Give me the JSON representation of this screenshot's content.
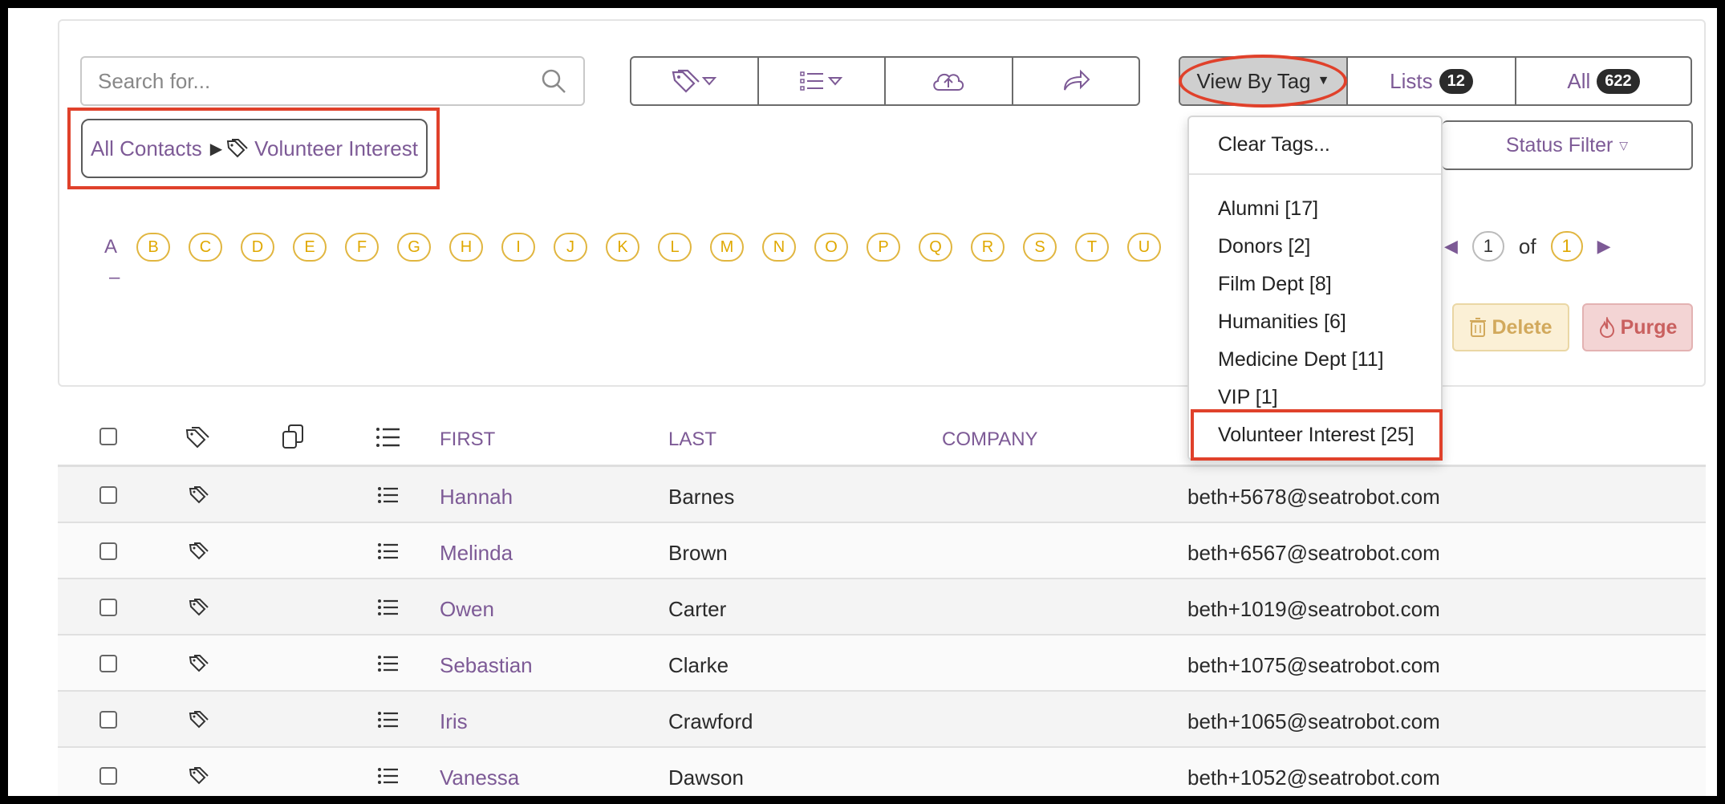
{
  "toolbar": {
    "search_placeholder": "Search for...",
    "view_by_tag_label": "View By Tag",
    "lists_label": "Lists",
    "lists_count": "12",
    "all_label": "All",
    "all_count": "622",
    "status_filter_label": "Status Filter"
  },
  "breadcrumb": {
    "root": "All Contacts",
    "current": "Volunteer Interest"
  },
  "letters": {
    "active": "A",
    "items": [
      "B",
      "C",
      "D",
      "E",
      "F",
      "G",
      "H",
      "I",
      "J",
      "K",
      "L",
      "M",
      "N",
      "O",
      "P",
      "Q",
      "R",
      "S",
      "T",
      "U"
    ],
    "extra": "–"
  },
  "pager": {
    "current": "1",
    "of_label": "of",
    "total": "1"
  },
  "actions": {
    "delete_label": "Delete",
    "purge_label": "Purge"
  },
  "table": {
    "headers": {
      "first": "FIRST",
      "last": "LAST",
      "company": "COMPANY"
    },
    "rows": [
      {
        "first": "Hannah",
        "last": "Barnes",
        "email": "beth+5678@seatrobot.com"
      },
      {
        "first": "Melinda",
        "last": "Brown",
        "email": "beth+6567@seatrobot.com"
      },
      {
        "first": "Owen",
        "last": "Carter",
        "email": "beth+1019@seatrobot.com"
      },
      {
        "first": "Sebastian",
        "last": "Clarke",
        "email": "beth+1075@seatrobot.com"
      },
      {
        "first": "Iris",
        "last": "Crawford",
        "email": "beth+1065@seatrobot.com"
      },
      {
        "first": "Vanessa",
        "last": "Dawson",
        "email": "beth+1052@seatrobot.com"
      }
    ]
  },
  "dropdown": {
    "clear": "Clear Tags...",
    "items": [
      "Alumni [17]",
      "Donors [2]",
      "Film Dept [8]",
      "Humanities [6]",
      "Medicine Dept [11]",
      "VIP [1]",
      "Volunteer Interest [25]"
    ]
  },
  "colors": {
    "accent_purple": "#7d5a96",
    "letter_yellow": "#e0a800",
    "highlight_red": "#e0412b"
  }
}
